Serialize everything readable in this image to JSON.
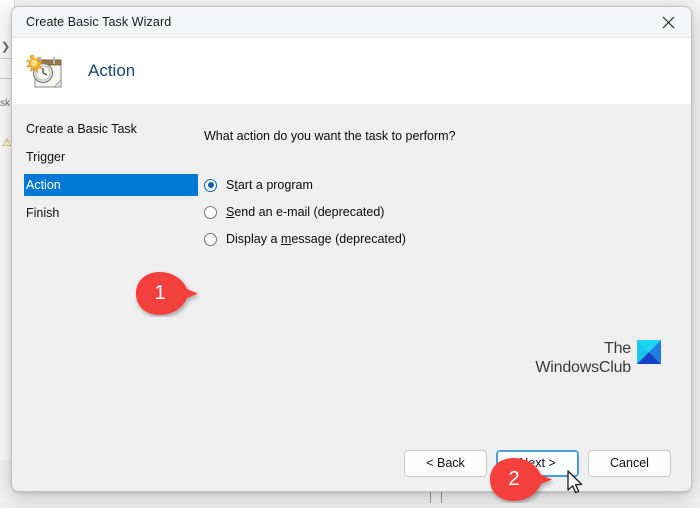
{
  "window": {
    "title": "Create Basic Task Wizard",
    "close_label": "Close",
    "close_icon": "close-x-icon",
    "app_icon": "task-scheduler-clock-calendar-icon"
  },
  "header": {
    "page_title": "Action"
  },
  "sidebar": {
    "steps": [
      {
        "label": "Create a Basic Task",
        "selected": false
      },
      {
        "label": "Trigger",
        "selected": false
      },
      {
        "label": "Action",
        "selected": true
      },
      {
        "label": "Finish",
        "selected": false
      }
    ],
    "selected_bg": "#0078d4",
    "selected_fg": "#ffffff"
  },
  "content": {
    "prompt": "What action do you want the task to perform?",
    "options": [
      {
        "id": "start-a-program",
        "label_before": "S",
        "label_accel": "t",
        "label_after": "art a program",
        "full_label": "Start a program",
        "checked": true
      },
      {
        "id": "send-an-email",
        "label_before": "",
        "label_accel": "S",
        "label_after": "end an e-mail (deprecated)",
        "full_label": "Send an e-mail (deprecated)",
        "checked": false
      },
      {
        "id": "display-a-message",
        "label_before": "Display a ",
        "label_accel": "m",
        "label_after": "essage (deprecated)",
        "full_label": "Display a message (deprecated)",
        "checked": false
      }
    ]
  },
  "watermark": {
    "line1": "The",
    "line2": "WindowsClub",
    "logo_colors": {
      "top": "#19d5f0",
      "left": "#16c4ec",
      "right": "#1f7fe0",
      "bottom": "#1440c8"
    }
  },
  "footer": {
    "back_label": "< Back",
    "next_label_before": "",
    "next_label_accel": "N",
    "next_label_after": "ext >",
    "next_full_label": "Next >",
    "cancel_label": "Cancel",
    "focused_button": "Next >"
  },
  "annotations": {
    "color": "#f4413c",
    "markers": [
      {
        "id": "marker-1",
        "number": "1",
        "points_at": "start-a-program-radio"
      },
      {
        "id": "marker-2",
        "number": "2",
        "points_at": "next-button"
      }
    ]
  },
  "accent": {
    "selection_blue": "#0078d4",
    "title_blue": "#16457e",
    "focus_blue": "#4a9ee0"
  }
}
